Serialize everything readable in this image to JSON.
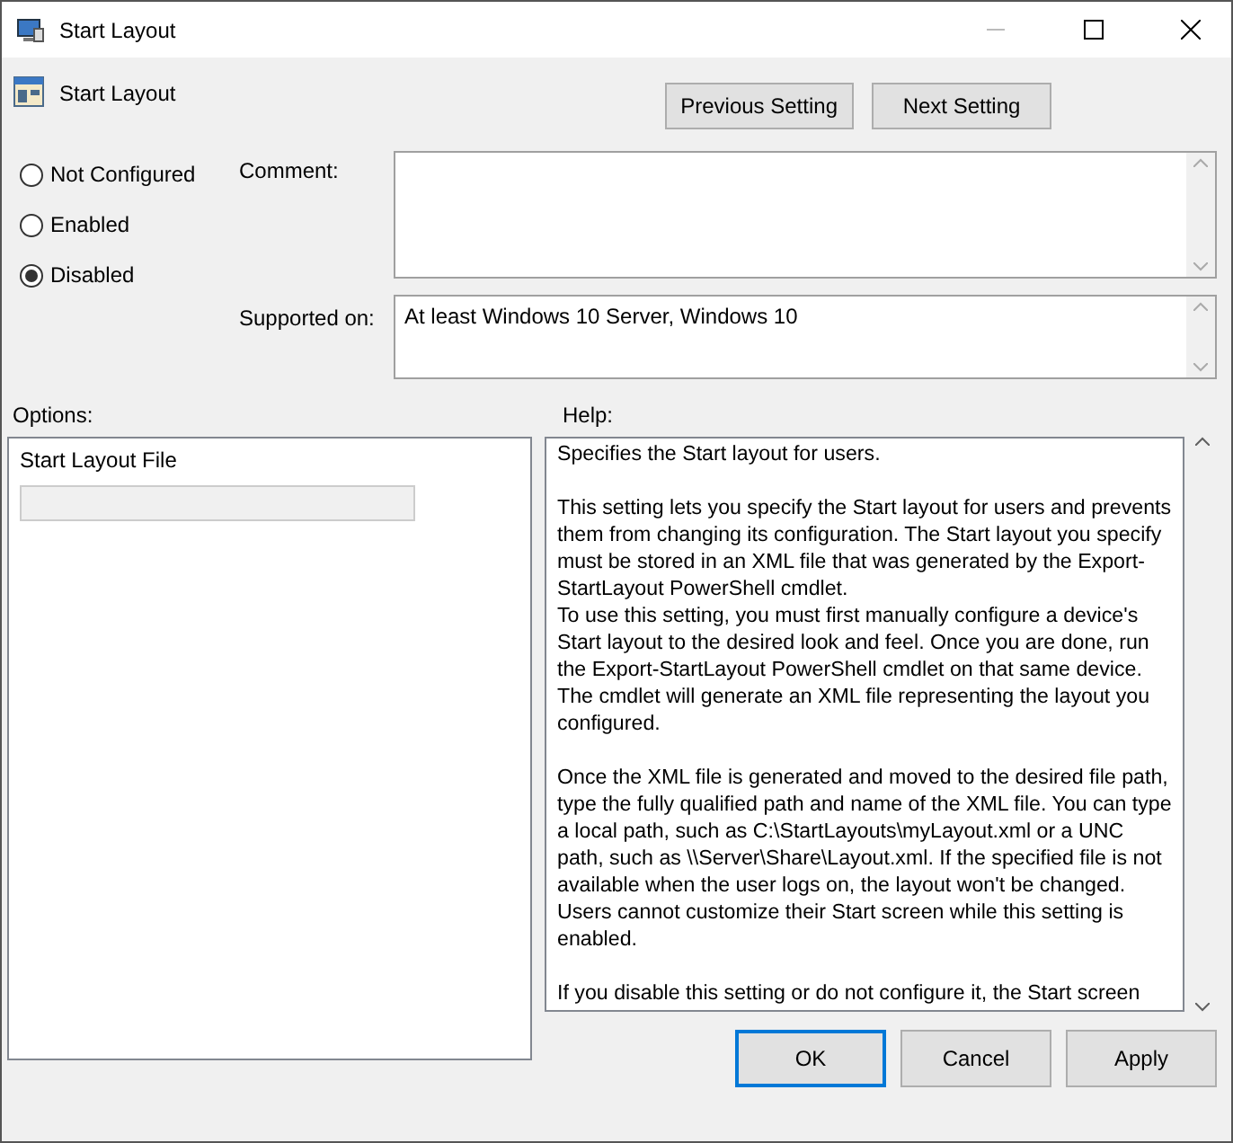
{
  "window": {
    "title": "Start Layout"
  },
  "setting": {
    "name": "Start Layout"
  },
  "nav_buttons": [
    "Previous Setting",
    "Next Setting"
  ],
  "states": [
    {
      "label": "Not Configured",
      "selected": false
    },
    {
      "label": "Enabled",
      "selected": false
    },
    {
      "label": "Disabled",
      "selected": true
    }
  ],
  "comment": {
    "label": "Comment:"
  },
  "supported_on": {
    "label": "Supported on:",
    "value": "At least Windows 10 Server, Windows 10"
  },
  "options": {
    "label": "Options:",
    "field_label": "Start Layout File",
    "field_disabled": true
  },
  "help": {
    "label": "Help:",
    "paragraphs": [
      "Specifies the Start layout for users.",
      "This setting lets you specify the Start layout for users and prevents them from changing its configuration. The Start layout you specify must be stored in an XML file that was generated by the Export-StartLayout PowerShell cmdlet.\nTo use this setting, you must first manually configure a device's Start layout to the desired look and feel. Once you are done, run the Export-StartLayout PowerShell cmdlet on that same device. The cmdlet will generate an XML file representing the layout you configured.",
      "Once the XML file is generated and moved to the desired file path, type the fully qualified path and name of the XML file. You can type a local path, such as C:\\StartLayouts\\myLayout.xml or a UNC path, such as \\\\Server\\Share\\Layout.xml. If the specified file is not available when the user logs on, the layout won't be changed. Users cannot customize their Start screen while this setting is enabled.",
      "If you disable this setting or do not configure it, the Start screen"
    ]
  },
  "buttons": [
    {
      "label": "OK",
      "selected": true
    },
    {
      "label": "Cancel",
      "selected": false
    },
    {
      "label": "Apply",
      "selected": false
    }
  ]
}
